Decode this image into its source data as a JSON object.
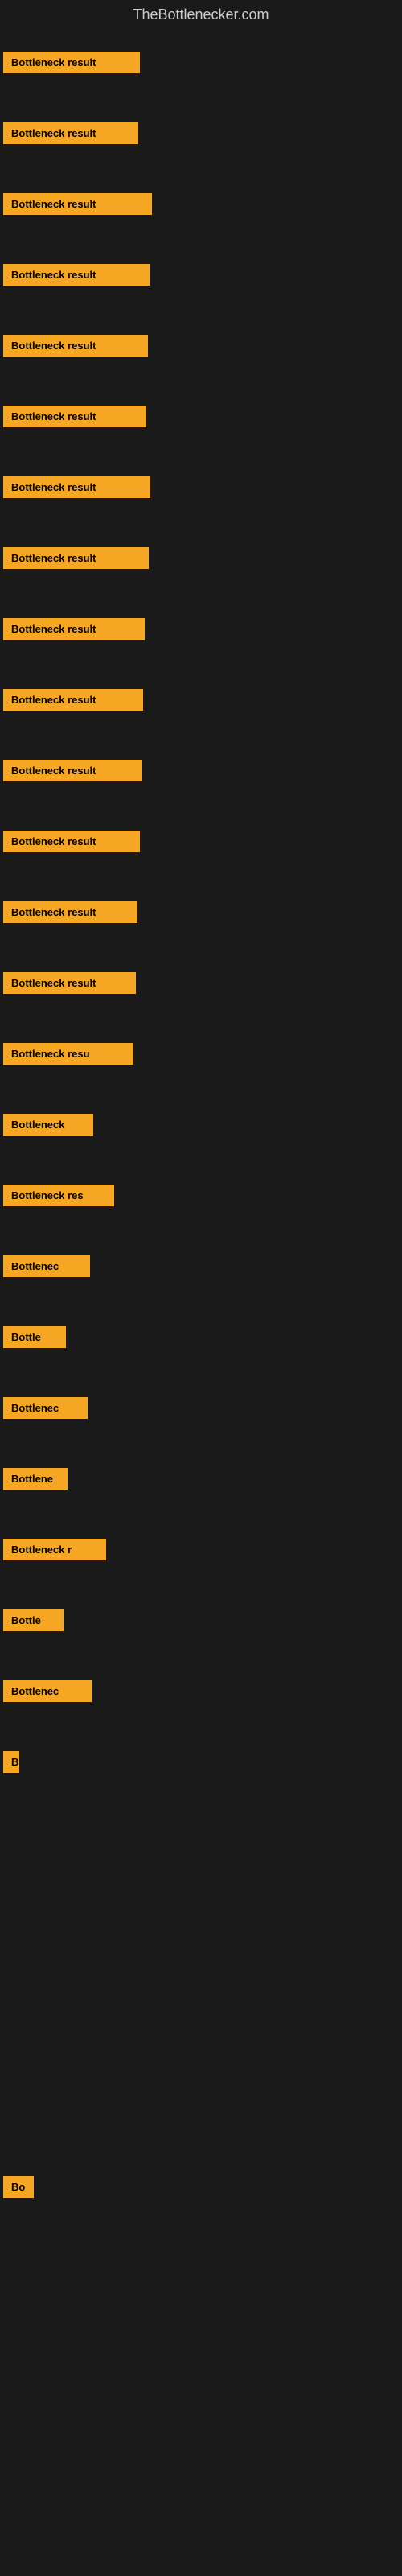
{
  "site": {
    "title": "TheBottlenecker.com"
  },
  "colors": {
    "background": "#1a1a1a",
    "badge_bg": "#f5a623",
    "badge_text": "#000000",
    "title_text": "#cccccc"
  },
  "rows": [
    {
      "id": 1,
      "label": "Bottleneck result",
      "visible": true
    },
    {
      "id": 2,
      "label": "Bottleneck result",
      "visible": true
    },
    {
      "id": 3,
      "label": "Bottleneck result",
      "visible": true
    },
    {
      "id": 4,
      "label": "Bottleneck result",
      "visible": true
    },
    {
      "id": 5,
      "label": "Bottleneck result",
      "visible": true
    },
    {
      "id": 6,
      "label": "Bottleneck result",
      "visible": true
    },
    {
      "id": 7,
      "label": "Bottleneck result",
      "visible": true
    },
    {
      "id": 8,
      "label": "Bottleneck result",
      "visible": true
    },
    {
      "id": 9,
      "label": "Bottleneck result",
      "visible": true
    },
    {
      "id": 10,
      "label": "Bottleneck result",
      "visible": true
    },
    {
      "id": 11,
      "label": "Bottleneck result",
      "visible": true
    },
    {
      "id": 12,
      "label": "Bottleneck result",
      "visible": true
    },
    {
      "id": 13,
      "label": "Bottleneck result",
      "visible": true
    },
    {
      "id": 14,
      "label": "Bottleneck result",
      "visible": true
    },
    {
      "id": 15,
      "label": "Bottleneck resu",
      "visible": true
    },
    {
      "id": 16,
      "label": "Bottleneck",
      "visible": true
    },
    {
      "id": 17,
      "label": "Bottleneck res",
      "visible": true
    },
    {
      "id": 18,
      "label": "Bottlenec",
      "visible": true
    },
    {
      "id": 19,
      "label": "Bottle",
      "visible": true
    },
    {
      "id": 20,
      "label": "Bottlenec",
      "visible": true
    },
    {
      "id": 21,
      "label": "Bottlene",
      "visible": true
    },
    {
      "id": 22,
      "label": "Bottleneck r",
      "visible": true
    },
    {
      "id": 23,
      "label": "Bottle",
      "visible": true
    },
    {
      "id": 24,
      "label": "Bottlenec",
      "visible": true
    },
    {
      "id": 25,
      "label": "B",
      "visible": true
    },
    {
      "id": 26,
      "label": "",
      "visible": false
    },
    {
      "id": 27,
      "label": "",
      "visible": false
    },
    {
      "id": 28,
      "label": "",
      "visible": false
    },
    {
      "id": 29,
      "label": "",
      "visible": false
    },
    {
      "id": 30,
      "label": "",
      "visible": false
    },
    {
      "id": 31,
      "label": "Bo",
      "visible": true
    },
    {
      "id": 32,
      "label": "",
      "visible": false
    },
    {
      "id": 33,
      "label": "",
      "visible": false
    },
    {
      "id": 34,
      "label": "",
      "visible": false
    },
    {
      "id": 35,
      "label": "",
      "visible": false
    },
    {
      "id": 36,
      "label": "",
      "visible": false
    }
  ]
}
